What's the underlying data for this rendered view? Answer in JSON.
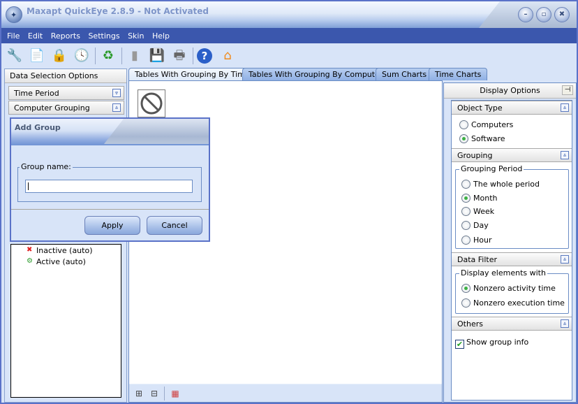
{
  "window": {
    "title": "Maxapt QuickEye 2.8.9 - Not Activated",
    "controls": [
      "minimize",
      "maximize",
      "close"
    ]
  },
  "menu": [
    "File",
    "Edit",
    "Reports",
    "Settings",
    "Skin",
    "Help"
  ],
  "toolbar": [
    {
      "icon": "tools-icon",
      "label": "Tools"
    },
    {
      "icon": "document-list-icon",
      "label": "Report"
    },
    {
      "icon": "lock-icon",
      "label": "Lock"
    },
    {
      "icon": "schedule-icon",
      "label": "Schedule"
    },
    {
      "icon": "refresh-icon",
      "label": "Refresh"
    },
    {
      "icon": "copy-icon",
      "label": "Copy"
    },
    {
      "icon": "save-icon",
      "label": "Save"
    },
    {
      "icon": "print-icon",
      "label": "Print"
    },
    {
      "icon": "help-icon",
      "label": "Help"
    },
    {
      "icon": "home-icon",
      "label": "Home"
    }
  ],
  "left_panel": {
    "title": "Data Selection Options",
    "sections": [
      {
        "label": "Time Period",
        "state": "collapsed"
      },
      {
        "label": "Computer Grouping",
        "state": "expanded"
      }
    ],
    "tree": [
      {
        "label": "Inactive (auto)"
      },
      {
        "label": "Active (auto)"
      }
    ]
  },
  "tabs": [
    {
      "label": "Tables With Grouping By Time",
      "active": true
    },
    {
      "label": "Tables With Grouping By Computers",
      "active": false
    },
    {
      "label": "Sum Charts",
      "active": false
    },
    {
      "label": "Time Charts",
      "active": false
    }
  ],
  "bottom_toolbar": [
    "expand-all-icon",
    "collapse-all-icon",
    "table-columns-icon"
  ],
  "right_panel": {
    "title": "Display Options",
    "object_type": {
      "label": "Object Type",
      "options": [
        "Computers",
        "Software"
      ],
      "selected": "Software"
    },
    "grouping": {
      "label": "Grouping",
      "group_label": "Grouping Period",
      "options": [
        "The whole period",
        "Month",
        "Week",
        "Day",
        "Hour"
      ],
      "selected": "Month"
    },
    "data_filter": {
      "label": "Data Filter",
      "group_label": "Display elements with",
      "options": [
        "Nonzero activity time",
        "Nonzero execution time"
      ],
      "selected": "Nonzero activity time"
    },
    "others": {
      "label": "Others",
      "show_group_info_label": "Show group info",
      "show_group_info": true
    }
  },
  "dialog": {
    "title": "Add Group",
    "field_label": "Group name:",
    "field_value": "",
    "apply_label": "Apply",
    "cancel_label": "Cancel"
  }
}
